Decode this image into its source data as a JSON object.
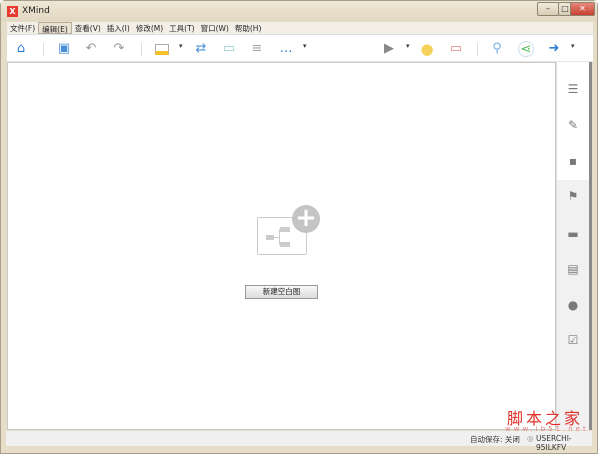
{
  "window": {
    "title": "XMind",
    "logo": "X"
  },
  "menu": [
    "文件(F)",
    "编辑(E)",
    "查看(V)",
    "插入(I)",
    "修改(M)",
    "工具(T)",
    "窗口(W)",
    "帮助(H)"
  ],
  "toolbar": {
    "icons": [
      "home-icon",
      "save-icon",
      "undo-icon",
      "redo-icon",
      "topic-icon",
      "relationship-icon",
      "boundary-icon",
      "summary-icon",
      "more-icon",
      "presentation-icon",
      "idea-icon",
      "gantt-icon",
      "search-icon",
      "share-icon",
      "export-icon"
    ]
  },
  "canvas": {
    "new_blank_label": "新建空白图"
  },
  "status": {
    "autosave": "自动保存: 关闭",
    "user": "USERCHI-95ILKFV"
  },
  "watermark": {
    "text": "脚本之家",
    "url": "www.jb51.net"
  }
}
